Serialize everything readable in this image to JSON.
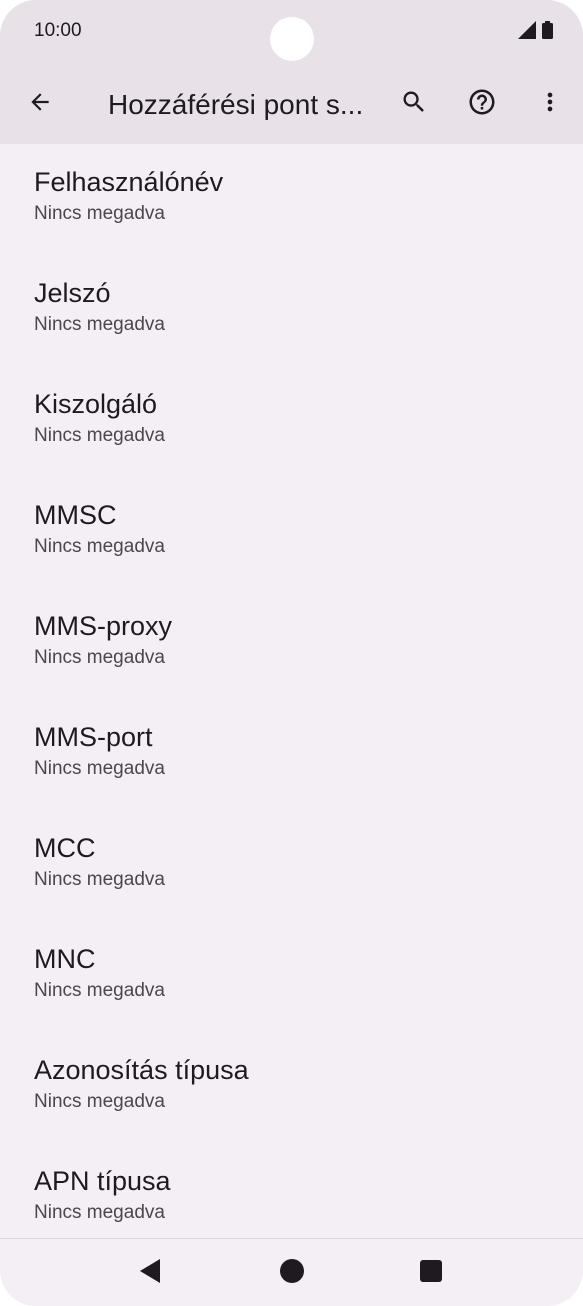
{
  "status_bar": {
    "time": "10:00",
    "icons": [
      "signal-icon",
      "battery-icon"
    ]
  },
  "app_bar": {
    "title": "Hozzáférési pont s...",
    "icons": [
      "back-arrow-icon",
      "search-icon",
      "help-icon",
      "more-vert-icon"
    ]
  },
  "items": [
    {
      "title": "Felhasználónév",
      "summary": "Nincs megadva"
    },
    {
      "title": "Jelszó",
      "summary": "Nincs megadva"
    },
    {
      "title": "Kiszolgáló",
      "summary": "Nincs megadva"
    },
    {
      "title": "MMSC",
      "summary": "Nincs megadva"
    },
    {
      "title": "MMS-proxy",
      "summary": "Nincs megadva"
    },
    {
      "title": "MMS-port",
      "summary": "Nincs megadva"
    },
    {
      "title": "MCC",
      "summary": "Nincs megadva"
    },
    {
      "title": "MNC",
      "summary": "Nincs megadva"
    },
    {
      "title": "Azonosítás típusa",
      "summary": "Nincs megadva"
    },
    {
      "title": "APN típusa",
      "summary": "Nincs megadva"
    }
  ],
  "nav_bar": {
    "icons": [
      "nav-back-icon",
      "nav-home-icon",
      "nav-recents-icon"
    ]
  },
  "colors": {
    "background": "#f4eef5",
    "app_bar": "#e8e1e8",
    "text_primary": "#1f1a20",
    "text_secondary": "#4f4550"
  }
}
